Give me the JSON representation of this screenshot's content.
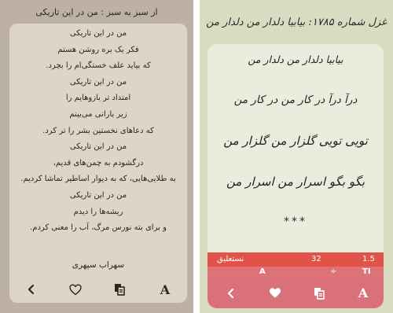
{
  "left_panel": {
    "title": "از سبز به سبز : من در این تاریکی",
    "lines": [
      "من در این تاریکی",
      "فکر یک بره روشن هستم",
      "که بیاید علف خستگی‌ام را بچرد.",
      "من در این تاریکی",
      "امتداد تر بازوهایم را",
      "زیر بارانی می‌بینم",
      "که دعاهای نخستین بشر را تر کرد.",
      "من در این تاریکی",
      "درگشودم به چمن‌های قدیم،",
      "به طلایی‌هایی، که به دیوار اساطیر تماشا کردیم.",
      "من در این تاریکی",
      "ریشه‌ها را دیدم",
      "و برای بته نورس مرگ، آب را معنی کردم."
    ],
    "author": "سهراب سپهری",
    "toolbar": {
      "back_icon": "chevron-left-icon",
      "favorite_icon": "heart-outline-icon",
      "copy_icon": "copy-icon",
      "font_label": "A"
    },
    "colors": {
      "background": "#bdb1a6",
      "card": "#ddd6c7",
      "text": "#2b2622"
    }
  },
  "right_panel": {
    "title": "غزل شماره ۱۷۸۵: بیابیا دلدار من دلدار من",
    "lines": [
      "بیابیا دلدار من دلدار من",
      "درآ درآ در کار من در کار من",
      "تویی تویی گلزار من گلزار من",
      "بگو بگو اسرار من اسرار من"
    ],
    "ornament": "***",
    "settings": {
      "font_name": "نستعلیق",
      "font_size": "32",
      "line_height": "1.5",
      "font_symbol": "A",
      "size_symbol": "÷",
      "spacing_symbol": "TI"
    },
    "toolbar": {
      "back_icon": "chevron-left-icon",
      "favorite_icon": "heart-filled-icon",
      "copy_icon": "copy-icon",
      "font_label": "A"
    },
    "colors": {
      "background": "#d9dcc0",
      "card": "#ebebde",
      "settings_bar": "#e15348",
      "toolbar": "#d9707a",
      "icon": "#ffffff"
    }
  }
}
